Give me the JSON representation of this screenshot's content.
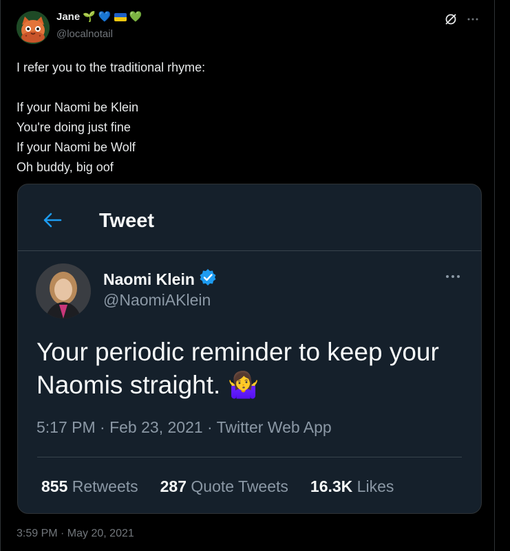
{
  "author": {
    "display_name": "Jane",
    "handle": "@localnotail",
    "name_emojis": [
      "seedling-emoji",
      "blue-heart-emoji",
      "ukraine-flag-emoji",
      "green-heart-emoji"
    ]
  },
  "tweet": {
    "text": "I refer you to the traditional rhyme:\n\nIf your Naomi be Klein\nYou're doing just fine\nIf your Naomi be Wolf\nOh buddy, big oof",
    "timestamp": "3:59 PM · May 20, 2021"
  },
  "embedded": {
    "header_title": "Tweet",
    "author_name": "Naomi Klein",
    "author_handle": "@NaomiAKlein",
    "verified": true,
    "body": "Your periodic reminder to keep your Naomis straight. 🤷‍♀️",
    "meta": "5:17 PM · Feb 23, 2021 · Twitter Web App",
    "stats": {
      "retweets_count": "855",
      "retweets_label": "Retweets",
      "quotes_count": "287",
      "quotes_label": "Quote Tweets",
      "likes_count": "16.3K",
      "likes_label": "Likes"
    }
  },
  "colors": {
    "background": "#000000",
    "card_background": "#15202b",
    "accent": "#1d9bf0",
    "muted": "#71767b"
  }
}
